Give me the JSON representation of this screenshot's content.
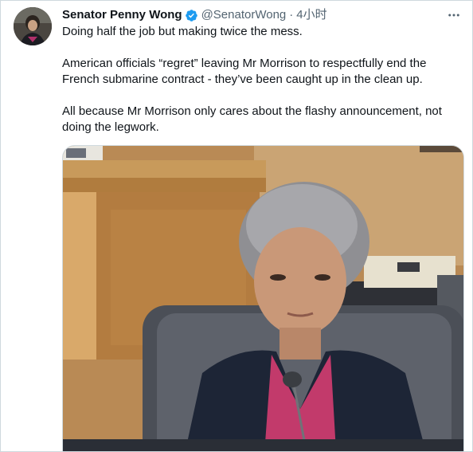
{
  "tweet": {
    "author_name": "Senator Penny Wong",
    "handle": "@SenatorWong",
    "separator": "·",
    "time": "4小时",
    "verified": true,
    "paragraphs": [
      "Doing half the job but making twice the mess.",
      "American officials “regret” leaving Mr Morrison to respectfully end the French submarine contract - they’ve been caught up in the clean up.",
      "All because Mr Morrison only cares about the flashy announcement, not doing the legwork."
    ]
  },
  "icons": {
    "verified": "verified-badge-icon",
    "more": "more-dots-icon"
  },
  "colors": {
    "verified_blue": "#1d9bf0",
    "text_primary": "#0f1419",
    "text_secondary": "#536471",
    "border": "#cfd9de"
  }
}
